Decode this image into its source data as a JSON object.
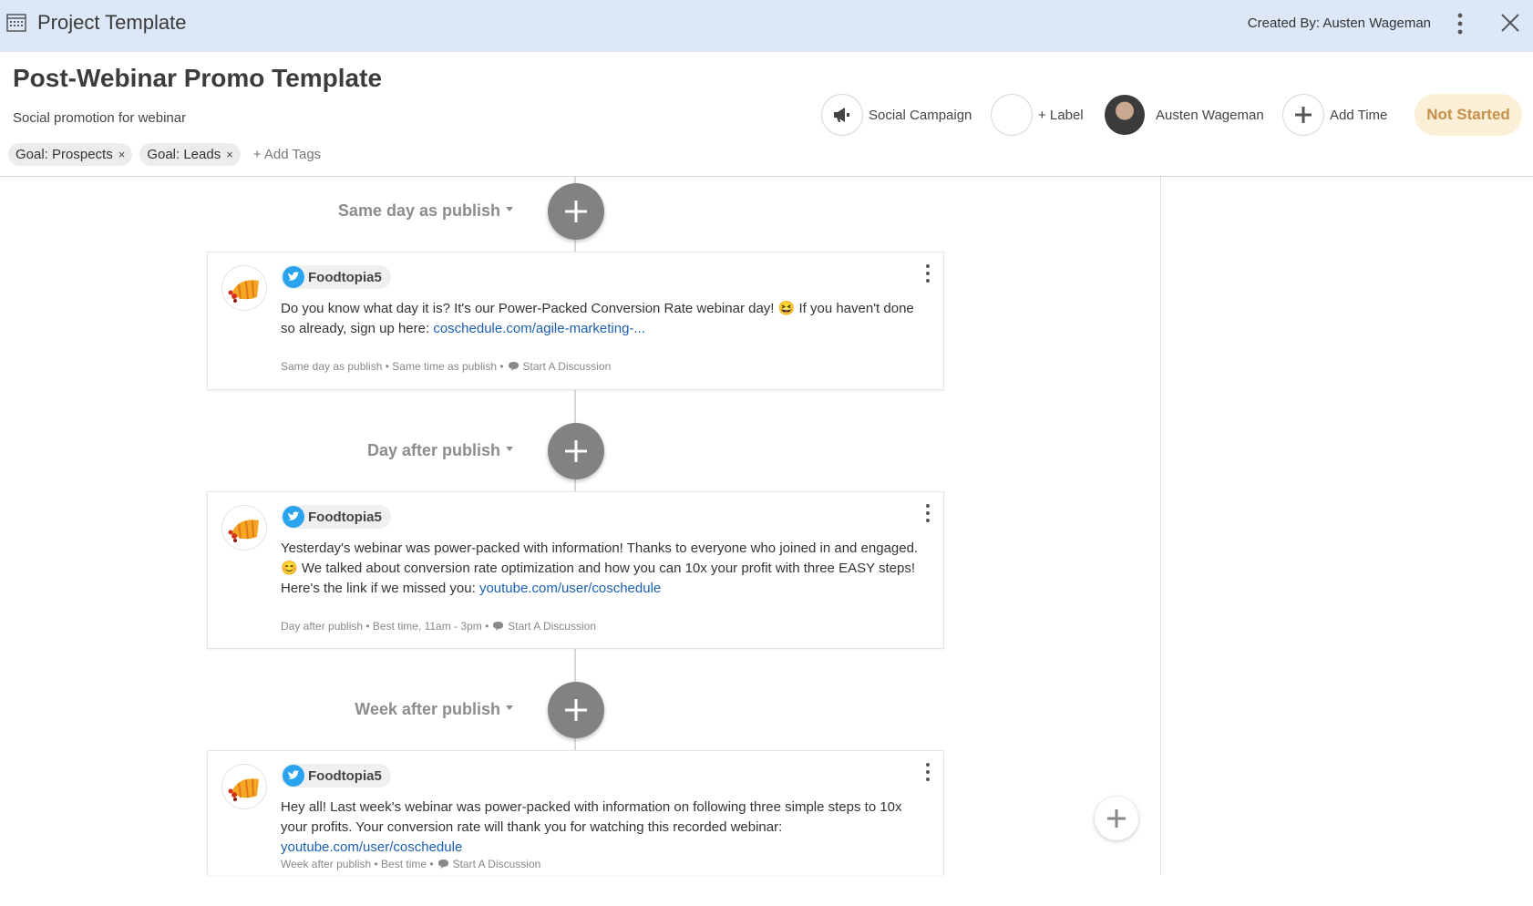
{
  "window": {
    "title": "Project Template",
    "created_by": "Created By: Austen Wageman"
  },
  "project": {
    "title": "Post-Webinar Promo Template",
    "description": "Social promotion for webinar"
  },
  "tags": [
    {
      "label": "Goal: Prospects",
      "remove": "×"
    },
    {
      "label": "Goal: Leads",
      "remove": "×"
    }
  ],
  "add_tags": "+ Add Tags",
  "meta": {
    "campaign": "Social Campaign",
    "label": "+ Label",
    "owner": "Austen Wageman",
    "time": "Add Time",
    "status": "Not Started"
  },
  "colors": {
    "topbar": "#dce7f8",
    "status_bg": "#fcefd7",
    "status_text": "#c4904a",
    "twitter": "#2aa3ef",
    "link": "#1b5fb0"
  },
  "sections": [
    {
      "heading": "Same day as publish",
      "post": {
        "account": "Foodtopia5",
        "network_icon": "twitter-icon",
        "text": "Do you know what day it is? It's our Power-Packed Conversion Rate webinar day! 😆 If you haven't done so already, sign up here: ",
        "link": "coschedule.com/agile-marketing-...",
        "timing": "Same day as publish • Same time as publish •",
        "discussion": "Start A Discussion"
      }
    },
    {
      "heading": "Day after publish",
      "post": {
        "account": "Foodtopia5",
        "network_icon": "twitter-icon",
        "text": "Yesterday's webinar was power-packed with information! Thanks to everyone who joined in and engaged. 😊 We talked about conversion rate optimization and how you can 10x your profit with three EASY steps! Here's the link if we missed you: ",
        "link": "youtube.com/user/coschedule",
        "timing": "Day after publish • Best time, 11am - 3pm •",
        "discussion": "Start A Discussion"
      }
    },
    {
      "heading": "Week after publish",
      "post": {
        "account": "Foodtopia5",
        "network_icon": "twitter-icon",
        "text": "Hey all! Last week's webinar was power-packed with information on following three simple steps to 10x your profits. Your conversion rate will thank you for watching this recorded webinar: ",
        "link": "youtube.com/user/coschedule",
        "timing": "Week after publish • Best time •",
        "discussion": "Start A Discussion"
      }
    }
  ]
}
